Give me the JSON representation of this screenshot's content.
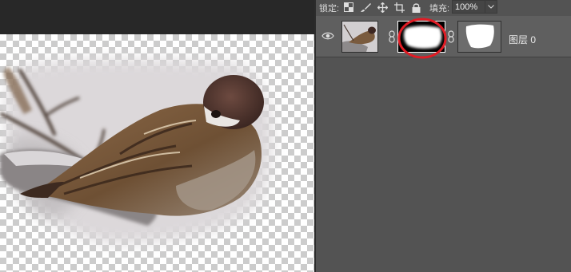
{
  "lock_bar": {
    "lock_label": "锁定:",
    "lock_icons": [
      "transparent-pixels-lock-icon",
      "image-pixels-brush-icon",
      "position-move-icon",
      "artboard-lock-icon",
      "lock-all-icon"
    ],
    "fill_label": "填充:",
    "fill_value": "100%"
  },
  "layer": {
    "name": "图层 0",
    "visible": true,
    "thumbnails": [
      "layer-image-thumbnail",
      "layer-mask-thumbnail",
      "vector-mask-thumbnail"
    ],
    "highlight_color": "#e01b24"
  },
  "canvas": {
    "background": "transparent-checkerboard",
    "subject": "sparrow-on-branch"
  }
}
